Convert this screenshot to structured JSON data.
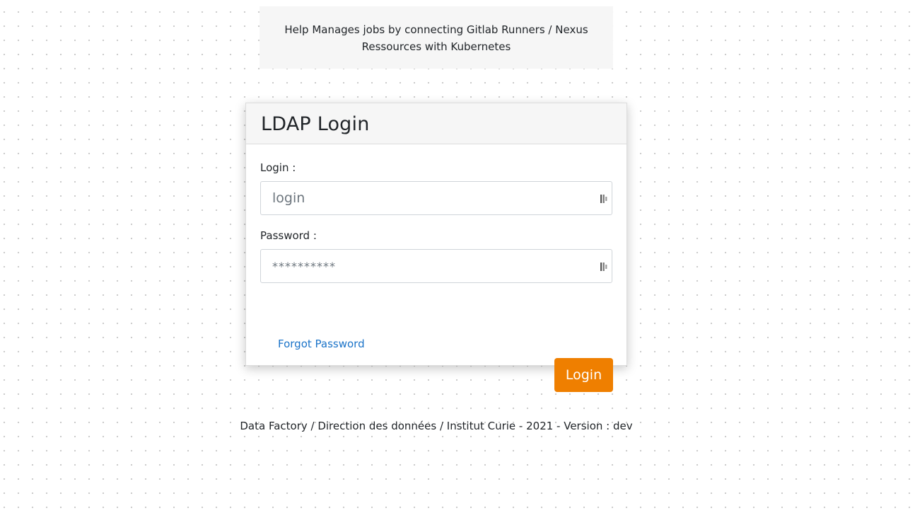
{
  "banner": {
    "text": "Help Manages jobs by connecting Gitlab Runners / Nexus Ressources with Kubernetes"
  },
  "login_card": {
    "title": "LDAP Login",
    "login_field": {
      "label": "Login :",
      "placeholder": "login",
      "value": ""
    },
    "password_field": {
      "label": "Password :",
      "placeholder": "**********",
      "value": ""
    },
    "forgot_password_link": "Forgot Password",
    "login_button": "Login"
  },
  "footer": {
    "text": "Data Factory / Direction des données / Institut Curie - 2021 - Version : dev"
  },
  "colors": {
    "accent": "#ef7f00",
    "link": "#1a73c8",
    "panel_background": "#f6f6f6"
  },
  "icons": {
    "input_autofill": "password-manager-icon"
  }
}
